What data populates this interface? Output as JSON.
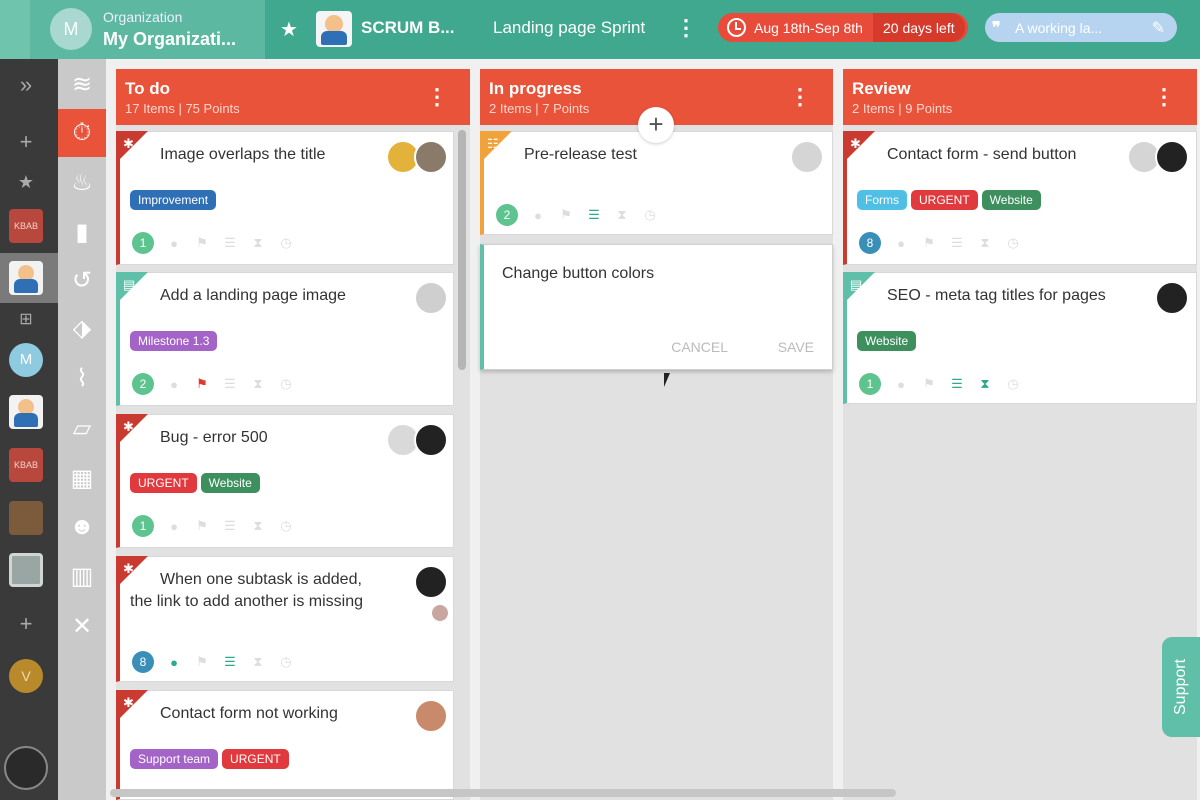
{
  "topbar": {
    "org_label": "Organization",
    "org_name": "My Organizati...",
    "org_initial": "M",
    "scrum_board": "SCRUM B...",
    "sprint": "Landing page Sprint",
    "dates": "Aug 18th-Sep 8th",
    "days_left": "20 days left",
    "goal": "A working la..."
  },
  "sidebar": {
    "kbab1": "KBAB",
    "kbab2": "KBAB",
    "m_initial": "M",
    "v_initial": "V"
  },
  "columns": [
    {
      "title": "To do",
      "subtitle": "17 Items | 75 Points"
    },
    {
      "title": "In progress",
      "subtitle": "2 Items | 7 Points"
    },
    {
      "title": "Review",
      "subtitle": "2 Items | 9 Points"
    }
  ],
  "cards": {
    "todo": [
      {
        "title": "Image overlaps the title",
        "tags": [
          "Improvement"
        ],
        "points": "1"
      },
      {
        "title": "Add a landing page image",
        "tags": [
          "Milestone 1.3"
        ],
        "points": "2"
      },
      {
        "title": "Bug - error 500",
        "tags": [
          "URGENT",
          "Website"
        ],
        "points": "1"
      },
      {
        "title": "When one subtask is added, the link to add another is missing",
        "tags": [],
        "points": "8"
      },
      {
        "title": "Contact form not working",
        "tags": [
          "Support team",
          "URGENT"
        ],
        "points": ""
      }
    ],
    "progress": [
      {
        "title": "Pre-release test",
        "tags": [],
        "points": "2"
      }
    ],
    "review": [
      {
        "title": "Contact form - send button",
        "tags": [
          "Forms",
          "URGENT",
          "Website"
        ],
        "points": "8"
      },
      {
        "title": "SEO - meta tag titles for pages",
        "tags": [
          "Website"
        ],
        "points": "1"
      }
    ]
  },
  "editor": {
    "text": "Change button colors",
    "cancel": "CANCEL",
    "save": "SAVE"
  },
  "support": "Support",
  "colors": {
    "brand": "#3fa88f",
    "accent": "#e9533a",
    "bug": "#c93a30"
  }
}
